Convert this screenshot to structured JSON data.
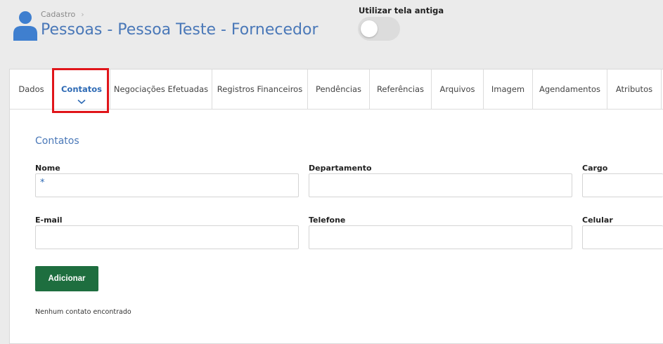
{
  "header": {
    "breadcrumb": "Cadastro",
    "title": "Pessoas - Pessoa Teste - Fornecedor",
    "old_screen_label": "Utilizar tela antiga",
    "old_screen_enabled": false
  },
  "tabs": [
    {
      "label": "Dados"
    },
    {
      "label": "Contatos",
      "active": true
    },
    {
      "label": "Negociações Efetuadas"
    },
    {
      "label": "Registros Financeiros"
    },
    {
      "label": "Pendências"
    },
    {
      "label": "Referências"
    },
    {
      "label": "Arquivos"
    },
    {
      "label": "Imagem"
    },
    {
      "label": "Agendamentos"
    },
    {
      "label": "Atributos"
    }
  ],
  "contacts": {
    "section_title": "Contatos",
    "fields": {
      "nome": {
        "label": "Nome",
        "required_marker": "*"
      },
      "departamento": {
        "label": "Departamento"
      },
      "cargo": {
        "label": "Cargo"
      },
      "email": {
        "label": "E-mail"
      },
      "telefone": {
        "label": "Telefone"
      },
      "celular": {
        "label": "Celular"
      }
    },
    "add_button": "Adicionar",
    "empty_message": "Nenhum contato encontrado"
  },
  "colors": {
    "accent": "#4a78b8",
    "active_tab": "#2f6bb5",
    "button": "#1e6e3f",
    "highlight": "#e0151a"
  }
}
